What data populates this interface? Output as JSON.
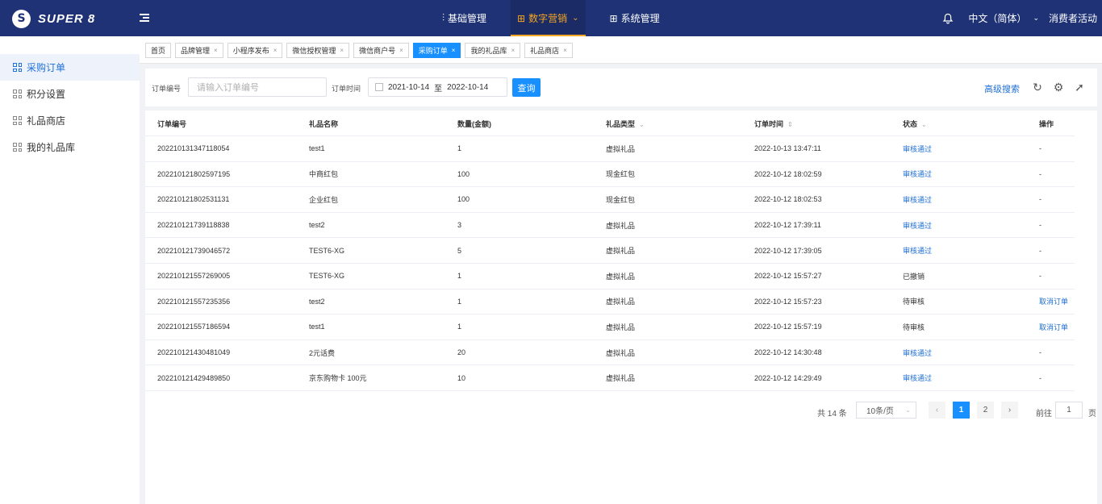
{
  "header": {
    "logo_mark": "S",
    "logo_text": "SUPER 8",
    "nav": [
      {
        "label": "基础管理",
        "icon": "sliders-icon"
      },
      {
        "label": "数字营销",
        "icon": "grid-icon",
        "active": true
      },
      {
        "label": "系统管理",
        "icon": "grid-icon"
      }
    ],
    "language": "中文（简体）",
    "activity": "消费者活动"
  },
  "sidebar": {
    "items": [
      {
        "label": "采购订单",
        "active": true
      },
      {
        "label": "积分设置"
      },
      {
        "label": "礼品商店"
      },
      {
        "label": "我的礼品库"
      }
    ]
  },
  "tags": [
    {
      "label": "首页",
      "closable": false
    },
    {
      "label": "品牌管理",
      "closable": true
    },
    {
      "label": "小程序发布",
      "closable": true
    },
    {
      "label": "微信授权管理",
      "closable": true
    },
    {
      "label": "微信商户号",
      "closable": true
    },
    {
      "label": "采购订单",
      "closable": true,
      "active": true
    },
    {
      "label": "我的礼品库",
      "closable": true
    },
    {
      "label": "礼品商店",
      "closable": true
    }
  ],
  "search": {
    "order_label": "订单编号",
    "order_placeholder": "请输入订单编号",
    "time_label": "订单时间",
    "date_from": "2021-10-14",
    "date_sep": "至",
    "date_to": "2022-10-14",
    "query_label": "查询",
    "advanced_label": "高级搜索"
  },
  "table": {
    "columns": [
      "订单编号",
      "礼品名称",
      "数量(金额)",
      "礼品类型",
      "订单时间",
      "状态",
      "操作"
    ],
    "rows": [
      [
        "202210131347118054",
        "test1",
        "1",
        "虚拟礼品",
        "2022-10-13 13:47:11",
        "审核通过",
        "-"
      ],
      [
        "202210121802597195",
        "中商红包",
        "100",
        "现金红包",
        "2022-10-12 18:02:59",
        "审核通过",
        "-"
      ],
      [
        "202210121802531131",
        "企业红包",
        "100",
        "现金红包",
        "2022-10-12 18:02:53",
        "审核通过",
        "-"
      ],
      [
        "202210121739118838",
        "test2",
        "3",
        "虚拟礼品",
        "2022-10-12 17:39:11",
        "审核通过",
        "-"
      ],
      [
        "202210121739046572",
        "TEST6-XG",
        "5",
        "虚拟礼品",
        "2022-10-12 17:39:05",
        "审核通过",
        "-"
      ],
      [
        "202210121557269005",
        "TEST6-XG",
        "1",
        "虚拟礼品",
        "2022-10-12 15:57:27",
        "已撤销",
        "-"
      ],
      [
        "202210121557235356",
        "test2",
        "1",
        "虚拟礼品",
        "2022-10-12 15:57:23",
        "待审核",
        "取消订单"
      ],
      [
        "202210121557186594",
        "test1",
        "1",
        "虚拟礼品",
        "2022-10-12 15:57:19",
        "待审核",
        "取消订单"
      ],
      [
        "202210121430481049",
        "2元话费",
        "20",
        "虚拟礼品",
        "2022-10-12 14:30:48",
        "审核通过",
        "-"
      ],
      [
        "202210121429489850",
        "京东购物卡 100元",
        "10",
        "虚拟礼品",
        "2022-10-12 14:29:49",
        "审核通过",
        "-"
      ]
    ]
  },
  "pagination": {
    "total": "共 14 条",
    "page_size": "10条/页",
    "pages": [
      "1",
      "2"
    ],
    "current": "1",
    "goto_prefix": "前往",
    "goto_value": "1",
    "goto_suffix": "页"
  },
  "colors": {
    "header": "#1f3275",
    "accent": "#f5a623",
    "primary": "#1890ff"
  }
}
